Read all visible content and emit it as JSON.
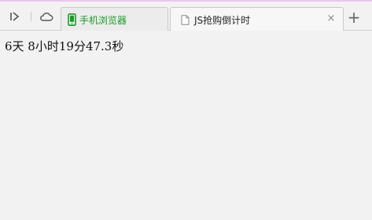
{
  "tabs": [
    {
      "label": "手机浏览器",
      "icon": "mobile-phone-icon",
      "color": "#1a9a2a"
    },
    {
      "label": "JS抢购倒计时",
      "icon": "page-icon",
      "active": true
    }
  ],
  "toolbar": {
    "sidebar_toggle_icon": "sidebar-toggle-icon",
    "cloud_icon": "cloud-icon",
    "new_tab_icon": "plus-icon"
  },
  "page": {
    "countdown_text": "6天 8小时19分47.3秒"
  }
}
